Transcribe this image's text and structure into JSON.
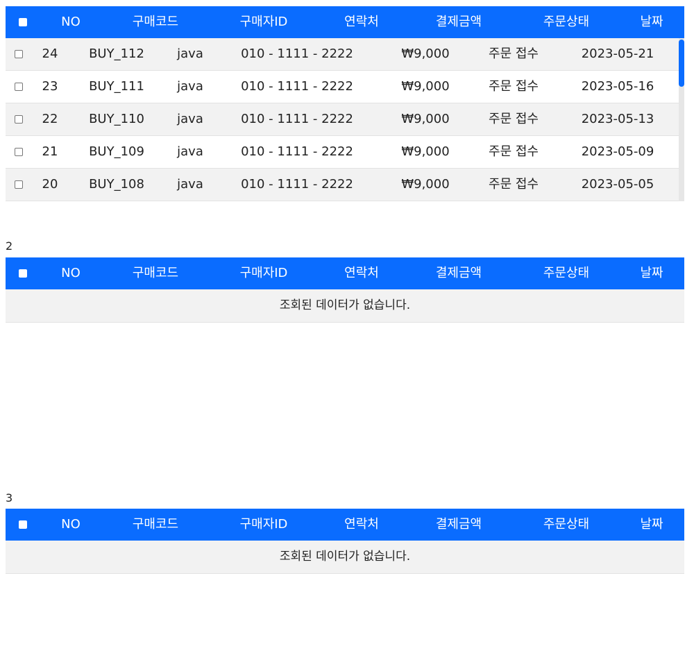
{
  "headers": [
    "NO",
    "구매코드",
    "구매자ID",
    "연락처",
    "결제금액",
    "주문상태",
    "날짜"
  ],
  "table1": {
    "rows": [
      {
        "no": "24",
        "code": "BUY_112",
        "buyer": "java",
        "phone": "010 - 1111 - 2222",
        "amount": "₩9,000",
        "status": "주문 접수",
        "date": "2023-05-21"
      },
      {
        "no": "23",
        "code": "BUY_111",
        "buyer": "java",
        "phone": "010 - 1111 - 2222",
        "amount": "₩9,000",
        "status": "주문 접수",
        "date": "2023-05-16"
      },
      {
        "no": "22",
        "code": "BUY_110",
        "buyer": "java",
        "phone": "010 - 1111 - 2222",
        "amount": "₩9,000",
        "status": "주문 접수",
        "date": "2023-05-13"
      },
      {
        "no": "21",
        "code": "BUY_109",
        "buyer": "java",
        "phone": "010 - 1111 - 2222",
        "amount": "₩9,000",
        "status": "주문 접수",
        "date": "2023-05-09"
      },
      {
        "no": "20",
        "code": "BUY_108",
        "buyer": "java",
        "phone": "010 - 1111 - 2222",
        "amount": "₩9,000",
        "status": "주문 접수",
        "date": "2023-05-05"
      }
    ]
  },
  "section2": {
    "label": "2",
    "empty_message": "조회된 데이터가 없습니다."
  },
  "section3": {
    "label": "3",
    "empty_message": "조회된 데이터가 없습니다."
  },
  "colors": {
    "header_bg": "#0a6cff",
    "row_alt": "#f2f2f2",
    "scroll_thumb": "#0a6cff"
  }
}
